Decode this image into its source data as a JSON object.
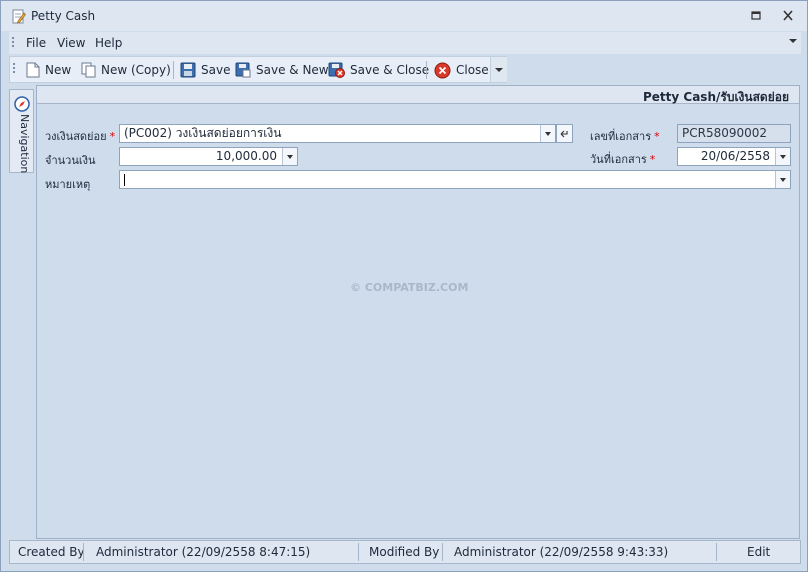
{
  "window": {
    "title": "Petty Cash"
  },
  "menu": {
    "items": [
      "File",
      "View",
      "Help"
    ]
  },
  "toolbar": {
    "new_label": "New",
    "new_copy_label": "New (Copy)",
    "save_label": "Save",
    "save_new_label": "Save & New",
    "save_close_label": "Save & Close",
    "close_label": "Close"
  },
  "navigation": {
    "label": "Navigation"
  },
  "panel": {
    "title": "Petty Cash/รับเงินสดย่อย"
  },
  "form": {
    "fund": {
      "label": "วงเงินสดย่อย",
      "required_mark": "*",
      "value": "(PC002) วงเงินสดย่อยการเงิน"
    },
    "amount": {
      "label": "จำนวนเงิน",
      "value": "10,000.00"
    },
    "remark": {
      "label": "หมายเหตุ",
      "value": ""
    },
    "doc_no": {
      "label": "เลขที่เอกสาร",
      "required_mark": "*",
      "value": "PCR58090002"
    },
    "doc_date": {
      "label": "วันที่เอกสาร",
      "required_mark": "*",
      "value": "20/06/2558"
    }
  },
  "watermark": "© COMPATBIZ.COM",
  "status": {
    "created_by_label": "Created By",
    "created_by_value": "Administrator (22/09/2558 8:47:15)",
    "modified_by_label": "Modified By",
    "modified_by_value": "Administrator (22/09/2558 9:43:33)",
    "mode": "Edit"
  }
}
